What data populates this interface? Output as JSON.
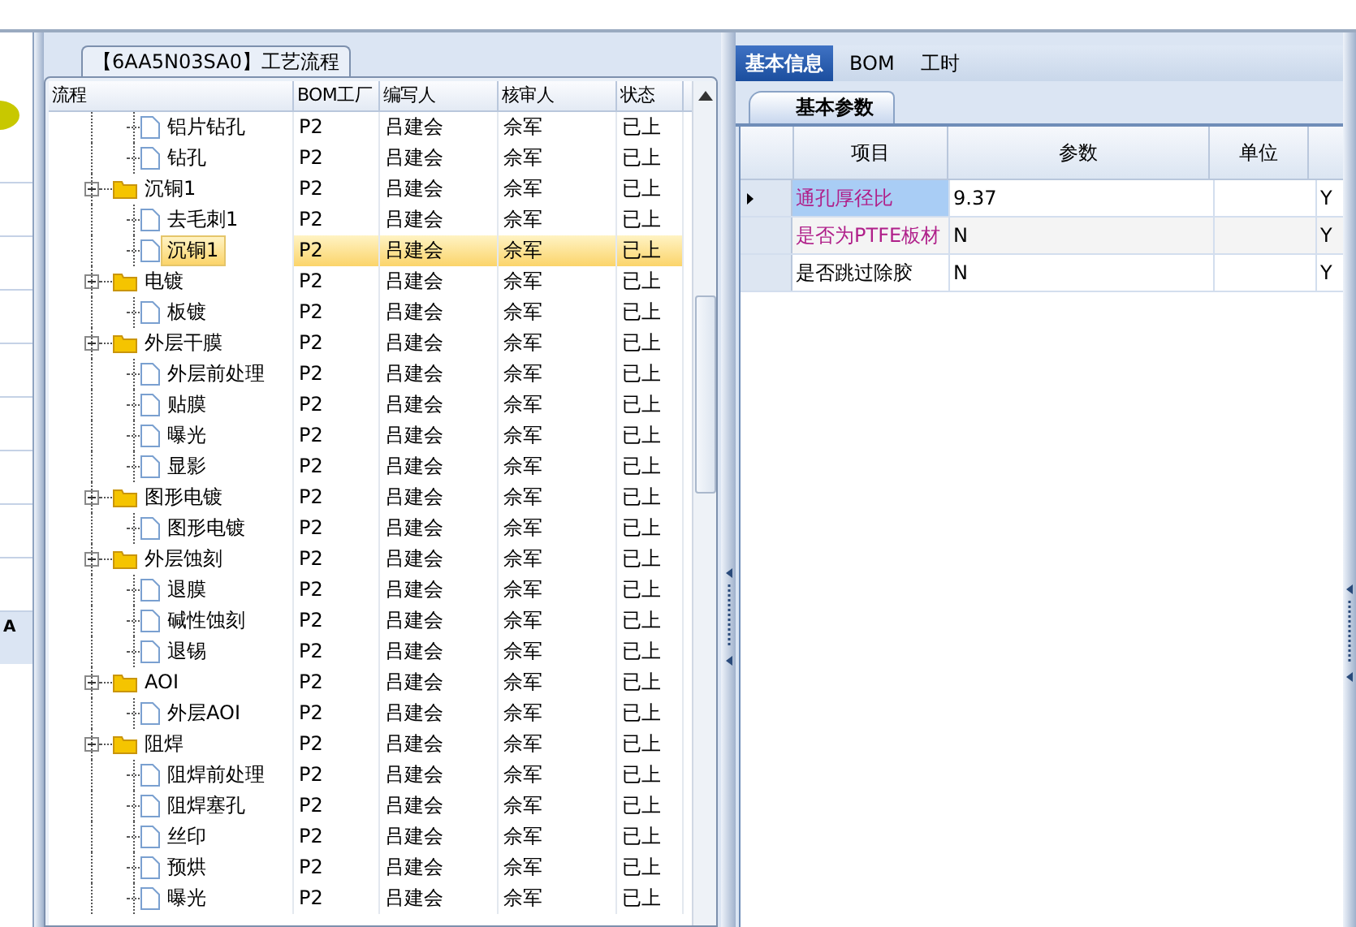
{
  "left_strip": {
    "label": "A"
  },
  "process_panel": {
    "title": "【6AA5N03SA0】工艺流程",
    "columns": [
      "流程",
      "BOM工厂",
      "编写人",
      "核审人",
      "状态"
    ],
    "tree": [
      {
        "children": [
          {
            "kind": "file",
            "name": "铝片钻孔",
            "bom": "P2",
            "author": "吕建会",
            "reviewer": "佘军",
            "status": "已上",
            "selected": false
          },
          {
            "kind": "file",
            "name": "钻孔",
            "bom": "P2",
            "author": "吕建会",
            "reviewer": "佘军",
            "status": "已上",
            "selected": false
          }
        ]
      },
      {
        "kind": "folder",
        "name": "沉铜1",
        "bom": "P2",
        "author": "吕建会",
        "reviewer": "佘军",
        "status": "已上",
        "selected": false,
        "expanded": true,
        "children": [
          {
            "kind": "file",
            "name": "去毛刺1",
            "bom": "P2",
            "author": "吕建会",
            "reviewer": "佘军",
            "status": "已上",
            "selected": false
          },
          {
            "kind": "file",
            "name": "沉铜1",
            "bom": "P2",
            "author": "吕建会",
            "reviewer": "佘军",
            "status": "已上",
            "selected": true
          }
        ]
      },
      {
        "kind": "folder",
        "name": "电镀",
        "bom": "P2",
        "author": "吕建会",
        "reviewer": "佘军",
        "status": "已上",
        "selected": false,
        "expanded": true,
        "children": [
          {
            "kind": "file",
            "name": "板镀",
            "bom": "P2",
            "author": "吕建会",
            "reviewer": "佘军",
            "status": "已上",
            "selected": false
          }
        ]
      },
      {
        "kind": "folder",
        "name": "外层干膜",
        "bom": "P2",
        "author": "吕建会",
        "reviewer": "佘军",
        "status": "已上",
        "selected": false,
        "expanded": true,
        "children": [
          {
            "kind": "file",
            "name": "外层前处理",
            "bom": "P2",
            "author": "吕建会",
            "reviewer": "佘军",
            "status": "已上",
            "selected": false
          },
          {
            "kind": "file",
            "name": "贴膜",
            "bom": "P2",
            "author": "吕建会",
            "reviewer": "佘军",
            "status": "已上",
            "selected": false
          },
          {
            "kind": "file",
            "name": "曝光",
            "bom": "P2",
            "author": "吕建会",
            "reviewer": "佘军",
            "status": "已上",
            "selected": false
          },
          {
            "kind": "file",
            "name": "显影",
            "bom": "P2",
            "author": "吕建会",
            "reviewer": "佘军",
            "status": "已上",
            "selected": false
          }
        ]
      },
      {
        "kind": "folder",
        "name": "图形电镀",
        "bom": "P2",
        "author": "吕建会",
        "reviewer": "佘军",
        "status": "已上",
        "selected": false,
        "expanded": true,
        "children": [
          {
            "kind": "file",
            "name": "图形电镀",
            "bom": "P2",
            "author": "吕建会",
            "reviewer": "佘军",
            "status": "已上",
            "selected": false
          }
        ]
      },
      {
        "kind": "folder",
        "name": "外层蚀刻",
        "bom": "P2",
        "author": "吕建会",
        "reviewer": "佘军",
        "status": "已上",
        "selected": false,
        "expanded": true,
        "children": [
          {
            "kind": "file",
            "name": "退膜",
            "bom": "P2",
            "author": "吕建会",
            "reviewer": "佘军",
            "status": "已上",
            "selected": false
          },
          {
            "kind": "file",
            "name": "碱性蚀刻",
            "bom": "P2",
            "author": "吕建会",
            "reviewer": "佘军",
            "status": "已上",
            "selected": false
          },
          {
            "kind": "file",
            "name": "退锡",
            "bom": "P2",
            "author": "吕建会",
            "reviewer": "佘军",
            "status": "已上",
            "selected": false
          }
        ]
      },
      {
        "kind": "folder",
        "name": "AOI",
        "bom": "P2",
        "author": "吕建会",
        "reviewer": "佘军",
        "status": "已上",
        "selected": false,
        "expanded": true,
        "children": [
          {
            "kind": "file",
            "name": "外层AOI",
            "bom": "P2",
            "author": "吕建会",
            "reviewer": "佘军",
            "status": "已上",
            "selected": false
          }
        ]
      },
      {
        "kind": "folder",
        "name": "阻焊",
        "bom": "P2",
        "author": "吕建会",
        "reviewer": "佘军",
        "status": "已上",
        "selected": false,
        "expanded": true,
        "children": [
          {
            "kind": "file",
            "name": "阻焊前处理",
            "bom": "P2",
            "author": "吕建会",
            "reviewer": "佘军",
            "status": "已上",
            "selected": false
          },
          {
            "kind": "file",
            "name": "阻焊塞孔",
            "bom": "P2",
            "author": "吕建会",
            "reviewer": "佘军",
            "status": "已上",
            "selected": false
          },
          {
            "kind": "file",
            "name": "丝印",
            "bom": "P2",
            "author": "吕建会",
            "reviewer": "佘军",
            "status": "已上",
            "selected": false
          },
          {
            "kind": "file",
            "name": "预烘",
            "bom": "P2",
            "author": "吕建会",
            "reviewer": "佘军",
            "status": "已上",
            "selected": false
          },
          {
            "kind": "file",
            "name": "曝光",
            "bom": "P2",
            "author": "吕建会",
            "reviewer": "佘军",
            "status": "已上",
            "selected": false
          }
        ]
      }
    ]
  },
  "detail_panel": {
    "tabs": [
      {
        "label": "基本信息",
        "selected": true
      },
      {
        "label": "BOM",
        "selected": false
      },
      {
        "label": "工时",
        "selected": false
      }
    ],
    "subtabs": [
      {
        "label": "基本参数",
        "selected": true
      }
    ],
    "columns": [
      "项目",
      "参数",
      "单位"
    ],
    "rows": [
      {
        "item": "通孔厚径比",
        "value": "9.37",
        "unit": "",
        "column_4": "Y",
        "color": "#b0208a",
        "selected": true
      },
      {
        "item": "是否为PTFE板材",
        "value": "N",
        "unit": "",
        "column_4": "Y",
        "color": "#b0208a",
        "selected": false
      },
      {
        "item": "是否跳过除胶",
        "value": "N",
        "unit": "",
        "column_4": "Y",
        "color": "#000000",
        "selected": false
      }
    ]
  }
}
